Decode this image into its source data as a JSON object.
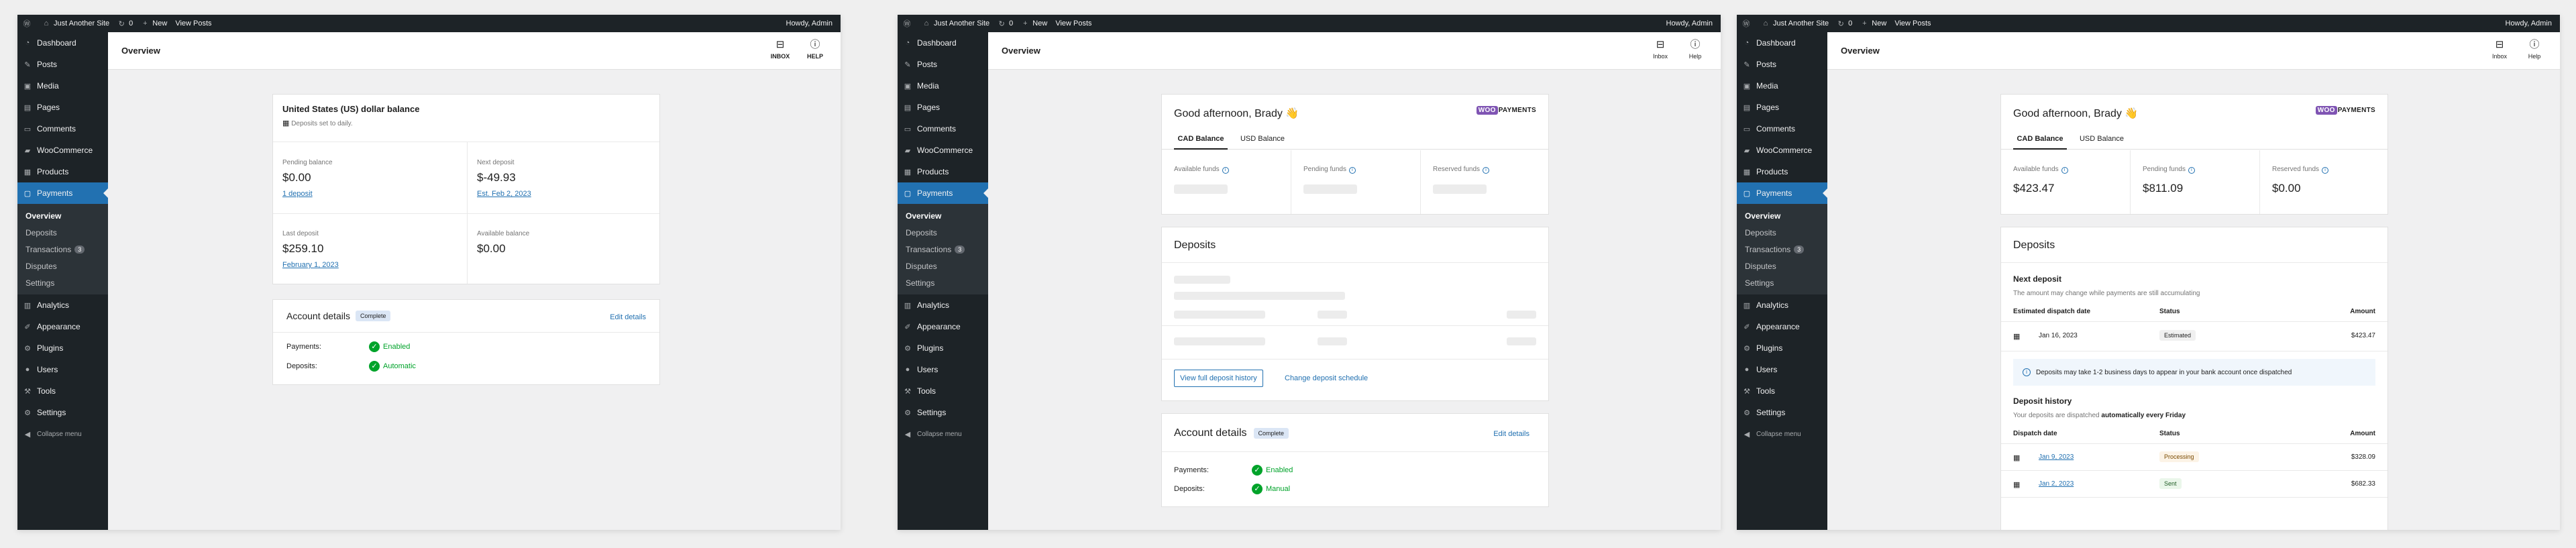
{
  "adminbar": {
    "site_name": "Just Another Site",
    "comments_count": "0",
    "new_label": "New",
    "view_posts_label": "View Posts",
    "howdy": "Howdy, Admin"
  },
  "sidebar": {
    "items_top": [
      "Dashboard",
      "Posts",
      "Media",
      "Pages",
      "Comments",
      "WooCommerce",
      "Products"
    ],
    "payments_label": "Payments",
    "submenu": [
      "Overview",
      "Deposits",
      "Transactions",
      "Disputes",
      "Settings"
    ],
    "transactions_badge": "3",
    "items_bottom": [
      "Analytics",
      "Appearance",
      "Plugins",
      "Users",
      "Tools",
      "Settings"
    ],
    "collapse_label": "Collapse menu"
  },
  "page_title": "Overview",
  "topbar_s1": {
    "inbox": "INBOX",
    "help": "HELP"
  },
  "topbar_s2": {
    "inbox": "Inbox",
    "help": "Help"
  },
  "s1": {
    "balance_title": "United States (US) dollar balance",
    "balance_subtitle": "Deposits set to daily.",
    "pending_label": "Pending balance",
    "pending_value": "$0.00",
    "pending_link": "1 deposit",
    "next_label": "Next deposit",
    "next_value": "$-49.93",
    "next_link": "Est. Feb 2, 2023",
    "last_label": "Last deposit",
    "last_value": "$259.10",
    "last_link": "February 1, 2023",
    "available_label": "Available balance",
    "available_value": "$0.00",
    "account_title": "Account details",
    "account_badge": "Complete",
    "edit_link": "Edit details",
    "payments_label": "Payments:",
    "payments_value": "Enabled",
    "deposits_label": "Deposits:",
    "deposits_value": "Automatic"
  },
  "s2": {
    "greeting": "Good afternoon, Brady 👋",
    "tab_cad": "CAD Balance",
    "tab_usd": "USD Balance",
    "available_label": "Available funds",
    "pending_label": "Pending funds",
    "reserved_label": "Reserved funds",
    "deposits_title": "Deposits",
    "view_history": "View full deposit history",
    "change_schedule": "Change deposit schedule",
    "account_title": "Account details",
    "account_badge": "Complete",
    "edit_link": "Edit details",
    "payments_label": "Payments:",
    "payments_value": "Enabled",
    "deposits_label": "Deposits:",
    "deposits_value": "Manual"
  },
  "s3": {
    "greeting": "Good afternoon, Brady 👋",
    "tab_cad": "CAD Balance",
    "tab_usd": "USD Balance",
    "available_label": "Available funds",
    "available_value": "$423.47",
    "pending_label": "Pending funds",
    "pending_value": "$811.09",
    "reserved_label": "Reserved funds",
    "reserved_value": "$0.00",
    "deposits_title": "Deposits",
    "next_title": "Next deposit",
    "next_desc": "The amount may change while payments are still accumulating",
    "next_cols": [
      "Estimated dispatch date",
      "Status",
      "Amount"
    ],
    "next_row": {
      "date": "Jan 16, 2023",
      "status": "Estimated",
      "amount": "$423.47"
    },
    "notice": "Deposits may take 1-2 business days to appear in your bank account once dispatched",
    "history_title": "Deposit history",
    "history_desc_pre": "Your deposits are dispatched ",
    "history_desc_bold": "automatically every Friday",
    "history_cols": [
      "Dispatch date",
      "Status",
      "Amount"
    ],
    "history_rows": [
      {
        "date": "Jan 9, 2023",
        "status": "Processing",
        "amount": "$328.09"
      },
      {
        "date": "Jan 2, 2023",
        "status": "Sent",
        "amount": "$682.33"
      }
    ]
  },
  "icons": [
    "wordpress-icon",
    "refresh-icon",
    "plus-icon",
    "inbox-icon",
    "help-icon",
    "calendar-icon",
    "info-icon",
    "check-icon"
  ]
}
